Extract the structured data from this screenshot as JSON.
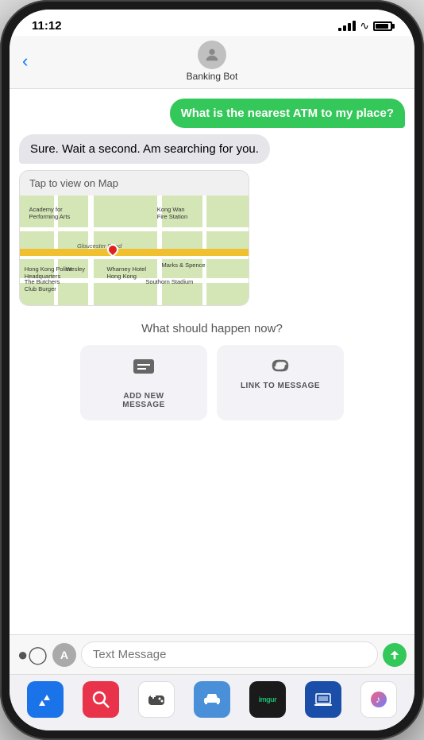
{
  "statusBar": {
    "time": "11:12"
  },
  "navBar": {
    "back": "‹",
    "title": "Banking Bot"
  },
  "chat": {
    "userMessage": "What is the nearest ATM to my place?",
    "botMessage": "Sure. Wait a second. Am searching for you.",
    "mapLabel": "Tap to view on Map"
  },
  "mapLabels": {
    "label1": "Academy for\nPerforming Arts",
    "label2": "Kong Wan\nFire Station",
    "label3": "Hong Kong Police\nHeadquarters",
    "label4": "Wesley",
    "label5": "Marks & Spence",
    "label6": "Wharney Hotel\nHong Kong",
    "label7": "The Butchers\nClub Burger",
    "label8": "Southorn Stadium",
    "road1": "Gloucester Road"
  },
  "actionSection": {
    "question": "What should happen now?",
    "btn1Label": "ADD NEW\nMESSAGE",
    "btn2Label": "LINK TO MESSAGE"
  },
  "inputBar": {
    "placeholder": "Text Message"
  },
  "dock": {
    "imgurLabel": "imgur"
  }
}
